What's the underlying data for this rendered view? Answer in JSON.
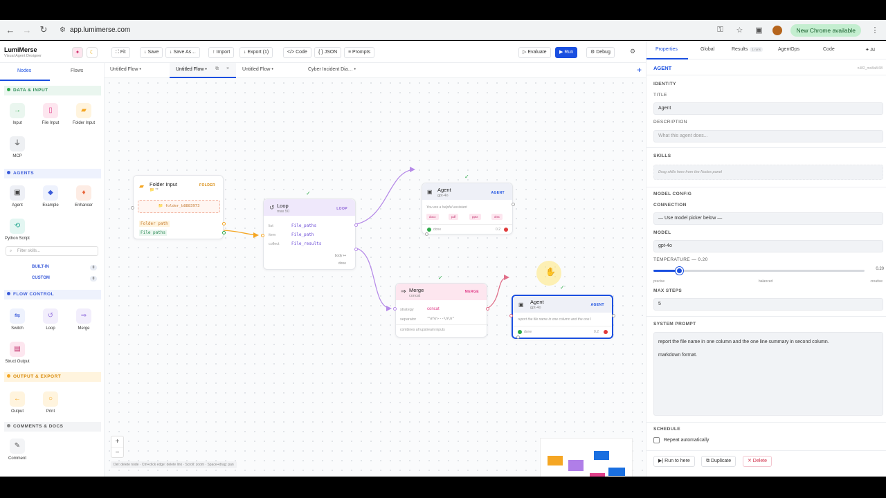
{
  "browser": {
    "url": "app.lumimerse.com",
    "new_chrome_label": "New Chrome available"
  },
  "app": {
    "title": "LumiMerse",
    "subtitle": "Visual Agent Designer"
  },
  "toolbar": {
    "fit": "⛶ Fit",
    "save": "↓ Save",
    "save_as": "↓ Save As…",
    "import": "↑ Import",
    "export": "↓ Export (1)",
    "code": "</> Code",
    "json": "{ } JSON",
    "prompts": "≡ Prompts",
    "evaluate": "▷ Evaluate",
    "run": "▶ Run",
    "debug": "⚙ Debug"
  },
  "sidebar": {
    "tabs": [
      "Nodes",
      "Flows"
    ],
    "sections": {
      "data": "DATA & INPUT",
      "agents": "AGENTS",
      "flow": "FLOW CONTROL",
      "output": "OUTPUT & EXPORT",
      "comments": "COMMENTS & DOCS"
    },
    "items": {
      "input": "Input",
      "file_input": "File Input",
      "folder_input": "Folder Input",
      "mcp": "MCP",
      "agent": "Agent",
      "example": "Example",
      "enhancer": "Enhancer",
      "python": "Python Script",
      "switch": "Switch",
      "loop": "Loop",
      "merge": "Merge",
      "struct": "Struct Output",
      "output": "Output",
      "print": "Print",
      "comment": "Comment"
    },
    "skill_filter_placeholder": "Filter skills...",
    "built_in": "BUILT-IN",
    "built_in_count": "0",
    "custom": "CUSTOM",
    "custom_count": "0"
  },
  "flow_tabs": [
    "Untitled Flow •",
    "Untitled Flow •",
    "Untitled Flow •",
    "Cyber Incident Dia… •"
  ],
  "nodes": {
    "folder": {
      "title": "Folder Input",
      "sub": "📁 **",
      "badge": "FOLDER",
      "path": "folder_b8883973",
      "out1": "Folder path",
      "out2": "File paths"
    },
    "loop": {
      "title": "Loop",
      "sub": "max 50",
      "badge": "LOOP",
      "rows": [
        [
          "list",
          "File_paths"
        ],
        [
          "item",
          "File_path"
        ],
        [
          "collect",
          "File_results"
        ]
      ],
      "body": "body ↦",
      "done": "done"
    },
    "agent1": {
      "title": "Agent",
      "sub": "gpt-4o",
      "badge": "AGENT",
      "prompt": "You are a helpful assistant",
      "chips": [
        "docx",
        "pdf",
        "pptx",
        "xlsx"
      ],
      "status": "done",
      "temp": "0.2"
    },
    "merge": {
      "title": "Merge",
      "sub": "concat",
      "badge": "MERGE",
      "strategy_k": "strategy",
      "strategy_v": "concat",
      "sep_k": "separator",
      "sep_v": "\"\\n\\n---\\n\\n\"",
      "note": "combines all upstream inputs"
    },
    "agent2": {
      "title": "Agent",
      "sub": "gpt-4o",
      "badge": "AGENT",
      "prompt": "report the file name in one column and the one l",
      "status": "done",
      "temp": "0.2"
    }
  },
  "canvas": {
    "hint": "Del: delete node · Ctrl+click edge: delete link · Scroll: zoom · Space+drag: pan"
  },
  "panel": {
    "tabs": [
      "Properties",
      "Global",
      "Results",
      "AgentOps",
      "Code",
      "✦ AI"
    ],
    "runs_badge": "1 runs",
    "node_type": "AGENT",
    "node_id": "n482_mo8a8r38",
    "identity": "IDENTITY",
    "title_label": "TITLE",
    "title_value": "Agent",
    "desc_label": "DESCRIPTION",
    "desc_placeholder": "What this agent does...",
    "skills_label": "SKILLS",
    "skills_placeholder": "Drag skills here from the Nodes panel",
    "model_config": "MODEL CONFIG",
    "connection_label": "CONNECTION",
    "connection_value": "— Use model picker below —",
    "model_label": "MODEL",
    "model_value": "gpt-4o",
    "temp_label": "TEMPERATURE — 0.20",
    "temp_value": "0.20",
    "temp_fraction": 0.12,
    "scale_labels": [
      "precise",
      "balanced",
      "creative"
    ],
    "max_steps_label": "MAX STEPS",
    "max_steps_value": "5",
    "system_prompt_label": "SYSTEM PROMPT",
    "system_prompt": "report the file name in one column and the one line summary in second column.\n\nmarkdown format.",
    "schedule_label": "SCHEDULE",
    "repeat_label": "Repeat automatically",
    "run_here": "▶| Run to here",
    "duplicate": "⧉ Duplicate",
    "delete": "✕ Delete"
  },
  "colors": {
    "accent": "#1a4fe0",
    "folder": "#f5a623",
    "loop": "#9b7be0",
    "merge": "#e0408a",
    "agent": "#1a4fe0",
    "done": "#2eaa4a",
    "error": "#e03a3a"
  }
}
